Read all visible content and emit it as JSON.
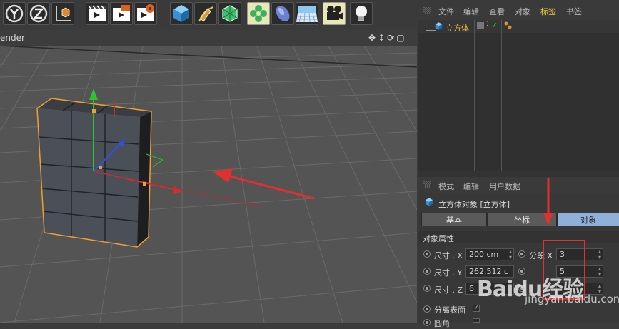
{
  "viewport": {
    "title": "ender"
  },
  "object_manager": {
    "menu": [
      "文件",
      "编辑",
      "查看",
      "对象",
      "标签",
      "书签"
    ],
    "active_menu_index": 4,
    "object_name": "立方体"
  },
  "attributes": {
    "menu": [
      "模式",
      "编辑",
      "用户数据"
    ],
    "object_title": "立方体对象 [立方体]",
    "tabs": [
      "基本",
      "坐标",
      "对象"
    ],
    "active_tab_index": 2,
    "section_title": "对象属性",
    "size_x_label": "尺寸 . X",
    "size_x_value": "200 cm",
    "size_y_label": "尺寸 . Y",
    "size_y_value": "262.512 c",
    "size_z_label": "尺寸 . Z",
    "size_z_value": "6",
    "seg_x_label": "分段 X",
    "seg_x_value": "3",
    "seg_y_value": "5",
    "separate_surfaces_label": "分离表面",
    "fillet_label": "圆角"
  },
  "watermark": {
    "text": "Baidu经验",
    "url": "jingyan.baidu.com"
  },
  "colors": {
    "accent_orange": "#f0a030",
    "annotation_red": "#e03030",
    "active_tab": "#8fb0d8",
    "axis_green": "#30c030",
    "axis_red": "#d03030",
    "axis_blue": "#3050e0"
  },
  "icons": [
    "y-axis-lock-icon",
    "z-axis-lock-icon",
    "coordinate-system-icon",
    "render-view-icon",
    "render-picture-viewer-icon",
    "render-settings-icon",
    "cube-primitive-icon",
    "pen-spline-icon",
    "subdivision-surface-icon",
    "cloner-icon",
    "deformer-icon",
    "floor-icon",
    "camera-icon",
    "light-icon"
  ]
}
